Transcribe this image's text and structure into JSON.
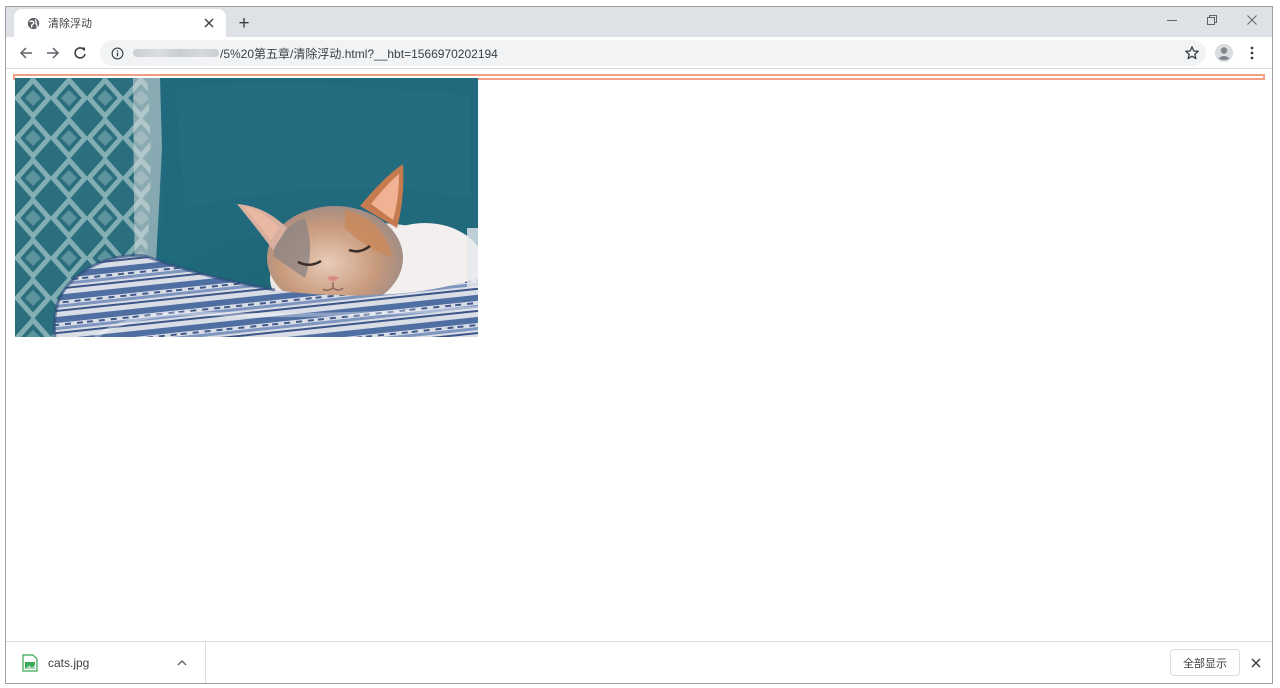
{
  "tab": {
    "title": "清除浮动",
    "favicon": "globe-icon",
    "close_icon": "close-icon"
  },
  "newtab": {
    "label": "+"
  },
  "window_controls": [
    "minimize-icon",
    "restore-icon",
    "close-icon"
  ],
  "toolbar": {
    "back_icon": "arrow-left-icon",
    "forward_icon": "arrow-right-icon",
    "reload_icon": "reload-icon",
    "info_icon": "info-icon",
    "url_visible": "/5%20第五章/清除浮动.html?__hbt=1566970202194",
    "bookmark_icon": "star-icon",
    "profile_icon": "avatar-icon",
    "menu_icon": "kebab-menu-icon"
  },
  "page": {
    "container_border_color": "#ef9f83",
    "image": {
      "subject": "sleeping calico cat on blanket",
      "file": "cats.jpg"
    }
  },
  "download_shelf": {
    "file_name": "cats.jpg",
    "file_icon": "image-file-icon",
    "expand_icon": "chevron-up-icon",
    "show_all_label": "全部显示",
    "close_icon": "close-icon"
  }
}
